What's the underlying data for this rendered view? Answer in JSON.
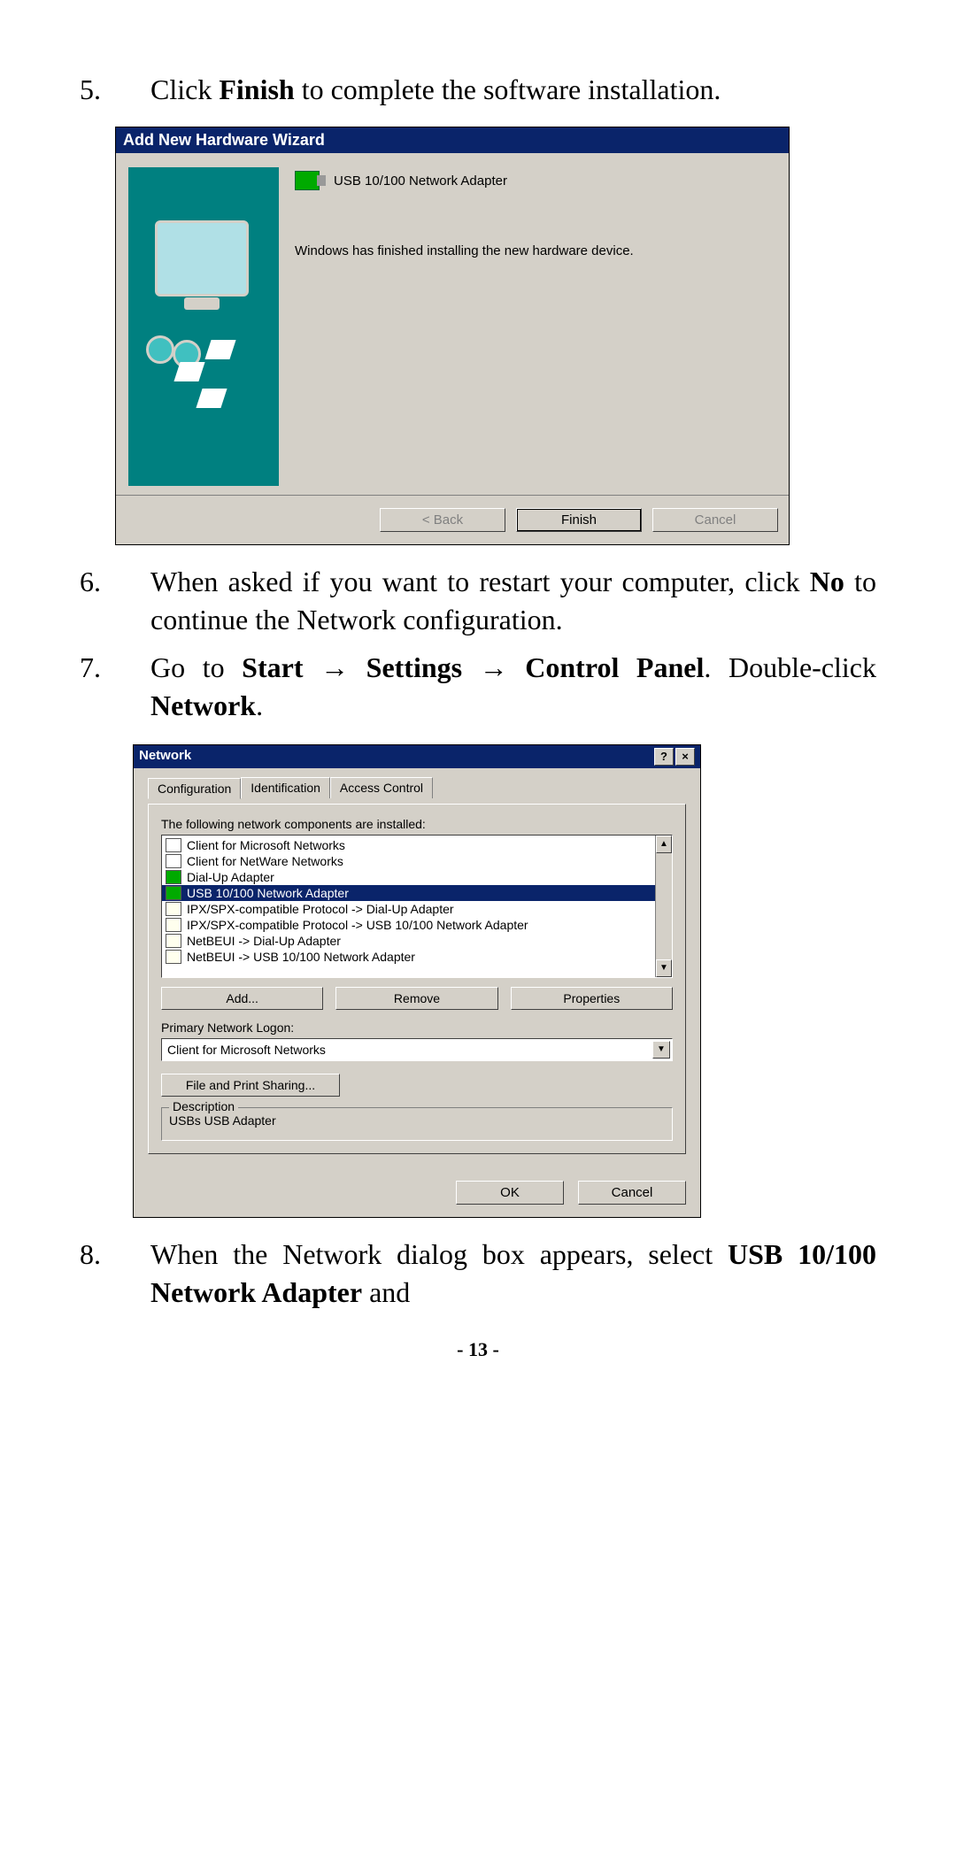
{
  "steps": {
    "s5": {
      "num": "5.",
      "pre": "Click ",
      "b1": "Finish",
      "post": " to complete the software installation."
    },
    "s6": {
      "num": "6.",
      "pre": "When asked if you want to restart your computer, click ",
      "b1": "No",
      "post": " to continue the Network configuration."
    },
    "s7": {
      "num": "7.",
      "pre": "Go to ",
      "b1": "Start → Settings → Control Panel",
      "mid": ". Double-click ",
      "b2": "Network",
      "post": "."
    },
    "s8": {
      "num": "8.",
      "pre": "When the Network dialog box appears, select ",
      "b1": "USB 10/100 Network Adapter",
      "post": " and"
    }
  },
  "wizard": {
    "title": "Add New Hardware Wizard",
    "device": "USB 10/100 Network Adapter",
    "message": "Windows has finished installing the new hardware device.",
    "buttons": {
      "back": "< Back",
      "finish": "Finish",
      "cancel": "Cancel"
    }
  },
  "network": {
    "title": "Network",
    "sys": {
      "help": "?",
      "close": "×"
    },
    "tabs": {
      "t1": "Configuration",
      "t2": "Identification",
      "t3": "Access Control"
    },
    "installed_label": "The following network components are installed:",
    "items": [
      "Client for Microsoft Networks",
      "Client for NetWare Networks",
      "Dial-Up Adapter",
      "USB 10/100 Network Adapter",
      "IPX/SPX-compatible Protocol -> Dial-Up Adapter",
      "IPX/SPX-compatible Protocol -> USB 10/100 Network Adapter",
      "NetBEUI -> Dial-Up Adapter",
      "NetBEUI -> USB 10/100 Network Adapter"
    ],
    "selected_index": 3,
    "btns": {
      "add": "Add...",
      "remove": "Remove",
      "props": "Properties"
    },
    "primary_label": "Primary Network Logon:",
    "primary_value": "Client for Microsoft Networks",
    "file_print": "File and Print Sharing...",
    "desc_legend": "Description",
    "desc_value": "USBs USB Adapter",
    "ok": "OK",
    "cancel": "Cancel"
  },
  "page_number": "- 13 -"
}
